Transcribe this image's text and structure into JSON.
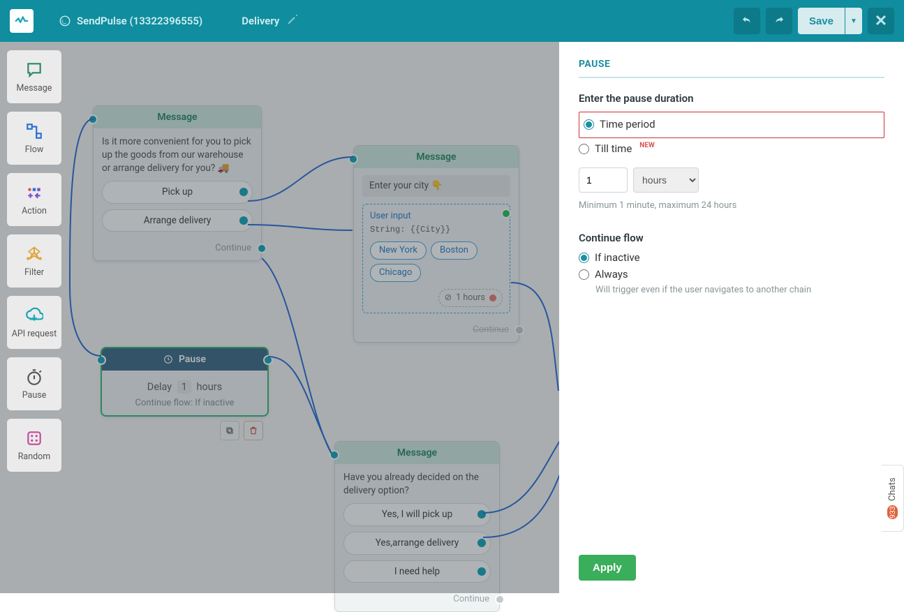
{
  "header": {
    "account": "SendPulse (13322396555)",
    "flow_name": "Delivery",
    "save_label": "Save"
  },
  "sidebar": {
    "items": [
      {
        "label": "Message"
      },
      {
        "label": "Flow"
      },
      {
        "label": "Action"
      },
      {
        "label": "Filter"
      },
      {
        "label": "API request"
      },
      {
        "label": "Pause"
      },
      {
        "label": "Random"
      }
    ]
  },
  "nodes": {
    "msg1": {
      "title": "Message",
      "text": "Is it more convenient for you to pick up the goods from our warehouse or arrange delivery for you? 🚚",
      "options": [
        "Pick up",
        "Arrange delivery"
      ],
      "footer": "Continue"
    },
    "msg2": {
      "title": "Message",
      "prompt": "Enter your city 👇",
      "user_input_label": "User input",
      "user_input_string": "String: {{City}}",
      "chips": [
        "New York",
        "Boston",
        "Chicago"
      ],
      "pause_badge": "1 hours",
      "footer": "Continue"
    },
    "pause": {
      "title": "Pause",
      "delay_prefix": "Delay",
      "delay_value": "1",
      "delay_unit": "hours",
      "sub": "Continue flow: If inactive"
    },
    "msg3": {
      "title": "Message",
      "text": "Have you already decided on the delivery option?",
      "options": [
        "Yes, I will pick up",
        "Yes,arrange delivery",
        "I need help"
      ],
      "footer": "Continue"
    }
  },
  "panel": {
    "title": "PAUSE",
    "duration_label": "Enter the pause duration",
    "radio_time_period": "Time period",
    "radio_till_time": "Till time",
    "new_badge": "NEW",
    "value": "1",
    "unit": "hours",
    "hint": "Minimum 1 minute, maximum 24 hours",
    "continue_label": "Continue flow",
    "radio_if_inactive": "If inactive",
    "radio_always": "Always",
    "always_hint": "Will trigger even if the user navigates to another chain",
    "apply": "Apply"
  },
  "chats": {
    "label": "Chats",
    "count": "933"
  }
}
